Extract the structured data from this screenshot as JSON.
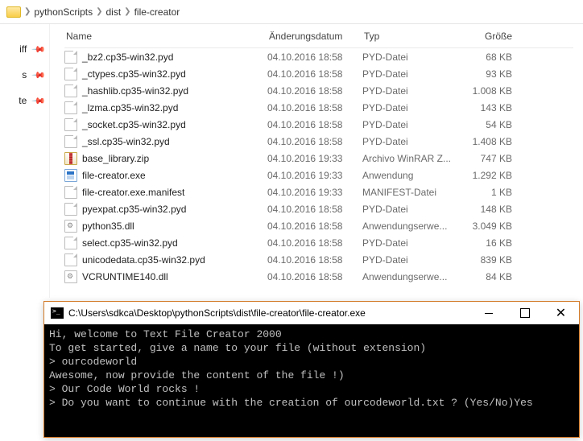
{
  "breadcrumb": [
    "pythonScripts",
    "dist",
    "file-creator"
  ],
  "sidebar": {
    "items": [
      "iff",
      "s",
      "te"
    ]
  },
  "columns": {
    "name": "Name",
    "date": "Änderungsdatum",
    "type": "Typ",
    "size": "Größe"
  },
  "files": [
    {
      "icon": "file",
      "name": "_bz2.cp35-win32.pyd",
      "date": "04.10.2016 18:58",
      "type": "PYD-Datei",
      "size": "68 KB"
    },
    {
      "icon": "file",
      "name": "_ctypes.cp35-win32.pyd",
      "date": "04.10.2016 18:58",
      "type": "PYD-Datei",
      "size": "93 KB"
    },
    {
      "icon": "file",
      "name": "_hashlib.cp35-win32.pyd",
      "date": "04.10.2016 18:58",
      "type": "PYD-Datei",
      "size": "1.008 KB"
    },
    {
      "icon": "file",
      "name": "_lzma.cp35-win32.pyd",
      "date": "04.10.2016 18:58",
      "type": "PYD-Datei",
      "size": "143 KB"
    },
    {
      "icon": "file",
      "name": "_socket.cp35-win32.pyd",
      "date": "04.10.2016 18:58",
      "type": "PYD-Datei",
      "size": "54 KB"
    },
    {
      "icon": "file",
      "name": "_ssl.cp35-win32.pyd",
      "date": "04.10.2016 18:58",
      "type": "PYD-Datei",
      "size": "1.408 KB"
    },
    {
      "icon": "zip",
      "name": "base_library.zip",
      "date": "04.10.2016 19:33",
      "type": "Archivo WinRAR Z...",
      "size": "747 KB"
    },
    {
      "icon": "exe",
      "name": "file-creator.exe",
      "date": "04.10.2016 19:33",
      "type": "Anwendung",
      "size": "1.292 KB"
    },
    {
      "icon": "file",
      "name": "file-creator.exe.manifest",
      "date": "04.10.2016 19:33",
      "type": "MANIFEST-Datei",
      "size": "1 KB"
    },
    {
      "icon": "file",
      "name": "pyexpat.cp35-win32.pyd",
      "date": "04.10.2016 18:58",
      "type": "PYD-Datei",
      "size": "148 KB"
    },
    {
      "icon": "dll",
      "name": "python35.dll",
      "date": "04.10.2016 18:58",
      "type": "Anwendungserwe...",
      "size": "3.049 KB"
    },
    {
      "icon": "file",
      "name": "select.cp35-win32.pyd",
      "date": "04.10.2016 18:58",
      "type": "PYD-Datei",
      "size": "16 KB"
    },
    {
      "icon": "file",
      "name": "unicodedata.cp35-win32.pyd",
      "date": "04.10.2016 18:58",
      "type": "PYD-Datei",
      "size": "839 KB"
    },
    {
      "icon": "dll",
      "name": "VCRUNTIME140.dll",
      "date": "04.10.2016 18:58",
      "type": "Anwendungserwe...",
      "size": "84 KB"
    }
  ],
  "console": {
    "title": "C:\\Users\\sdkca\\Desktop\\pythonScripts\\dist\\file-creator\\file-creator.exe",
    "lines": [
      "Hi, welcome to Text File Creator 2000",
      "To get started, give a name to your file (without extension)",
      "> ourcodeworld",
      "Awesome, now provide the content of the file !)",
      "> Our Code World rocks !",
      "> Do you want to continue with the creation of ourcodeworld.txt ? (Yes/No)Yes"
    ]
  }
}
